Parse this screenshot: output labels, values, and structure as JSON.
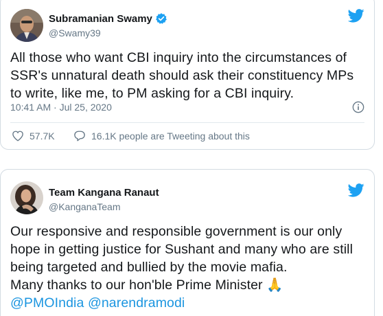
{
  "tweets": [
    {
      "author": {
        "name": "Subramanian Swamy",
        "handle": "@Swamy39",
        "verified": true
      },
      "text": "All those who want CBI inquiry into the circumstances of SSR's unnatural death should ask their constituency MPs to write, like me, to PM asking for a CBI inquiry.",
      "timestamp": "10:41 AM · Jul 25, 2020",
      "likes": "57.7K",
      "tweeting_about": "16.1K people are Tweeting about this"
    },
    {
      "author": {
        "name": "Team Kangana Ranaut",
        "handle": "@KanganaTeam",
        "verified": false
      },
      "text_lines": [
        "Our responsive and responsible government is our only hope in getting justice for Sushant and many who are still being targeted and bullied by the movie mafia.",
        "Many thanks to our hon'ble Prime Minister"
      ],
      "emoji": "🙏",
      "mentions": [
        "@PMOIndia",
        "@narendramodi"
      ]
    }
  ],
  "colors": {
    "brand": "#1da1f2",
    "link": "#1b95e0",
    "secondary_text": "#657786",
    "verified": "#1da1f2",
    "border": "#d3dbe2"
  },
  "icons": [
    "twitter-bird-icon",
    "verified-badge-icon",
    "info-icon",
    "heart-icon",
    "reply-bubble-icon",
    "folded-hands-emoji"
  ]
}
